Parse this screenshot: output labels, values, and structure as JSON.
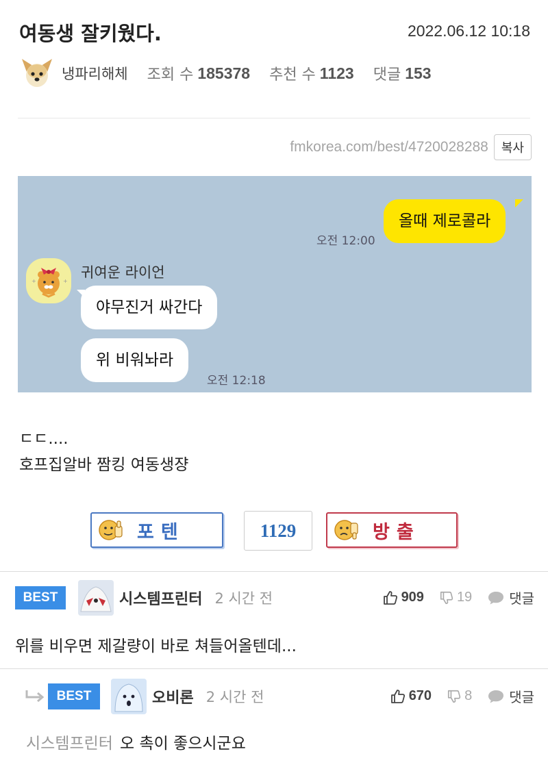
{
  "post": {
    "title": "여동생 잘키웠다.",
    "datetime": "2022.06.12 10:18",
    "author": "냉파리해체",
    "views_label": "조회 수",
    "views": "185378",
    "recommend_label": "추천 수",
    "recommend": "1123",
    "comments_label": "댓글",
    "comments": "153",
    "url": "fmkorea.com/best/4720028288",
    "copy_label": "복사",
    "body_lines": [
      "ㄷㄷ....",
      "호프집알바 짬킹 여동생쟝"
    ]
  },
  "chat": {
    "my_message": "올때 제로콜라",
    "my_time": "오전 12:00",
    "sender": "귀여운 라이언",
    "reply_1": "야무진거 싸간다",
    "reply_2": "위 비워놔라",
    "reply_time": "오전 12:18"
  },
  "vote": {
    "up_label": "포텐",
    "count": "1129",
    "down_label": "방출"
  },
  "comments": [
    {
      "badge": "BEST",
      "nick": "시스템프린터",
      "time": "2 시간 전",
      "likes": "909",
      "dislikes": "19",
      "reply_label": "댓글",
      "text": "위를 비우면 제갈량이 바로 쳐들어올텐데..."
    },
    {
      "badge": "BEST",
      "nick": "오비론",
      "time": "2 시간 전",
      "likes": "670",
      "dislikes": "8",
      "reply_label": "댓글",
      "mention": "시스템프린터",
      "text": "오 촉이 좋으시군요"
    }
  ],
  "icons": {
    "thumb_up": "thumbs-up-icon",
    "thumb_down": "thumbs-down-icon",
    "reply": "speech-bubble-icon",
    "reply_arrow": "reply-arrow-icon"
  },
  "colors": {
    "best_badge": "#3a8ee6",
    "chat_bg": "#b2c7d9",
    "my_bubble": "#fee500",
    "potent": "#3a6ec0",
    "bang": "#c02b3e"
  }
}
